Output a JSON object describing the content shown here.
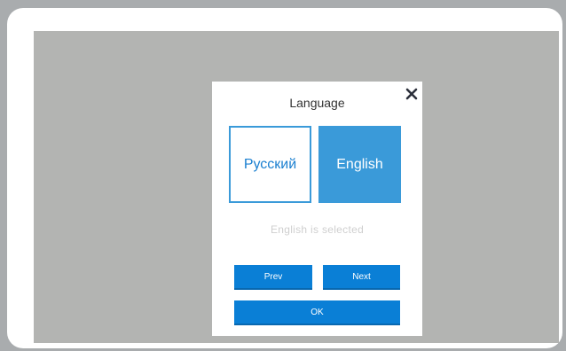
{
  "dialog": {
    "title": "Language",
    "close_icon": "close-icon",
    "options": [
      {
        "label": "Русский",
        "selected": false
      },
      {
        "label": "English",
        "selected": true
      }
    ],
    "status_text": "English is selected",
    "prev_label": "Prev",
    "next_label": "Next",
    "ok_label": "OK"
  },
  "colors": {
    "accent": "#3a9ad9",
    "button": "#0a7fd6",
    "overlay": "#b3b4b2",
    "status_text": "#cfcfcf"
  }
}
